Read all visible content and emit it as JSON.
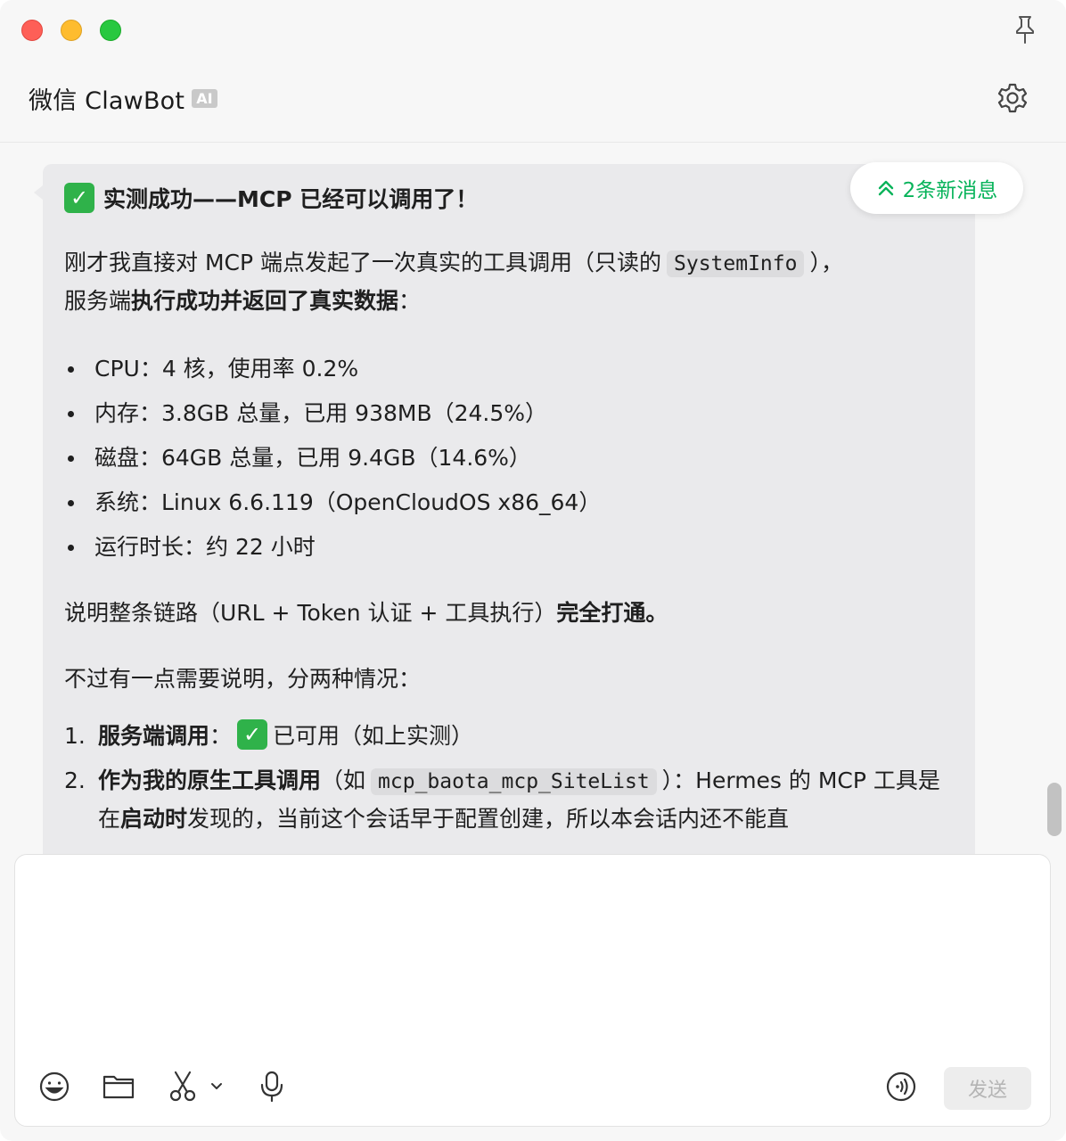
{
  "window": {
    "title": "微信 ClawBot",
    "ai_badge": "AI"
  },
  "chat": {
    "new_messages_label": "2条新消息",
    "message": {
      "heading": "实测成功——MCP 已经可以调用了！",
      "intro_1": "刚才我直接对 MCP 端点发起了一次真实的工具调用（只读的",
      "intro_code": "SystemInfo",
      "intro_2": "），",
      "intro_3": "服务端",
      "intro_bold": "执行成功并返回了真实数据",
      "intro_4": "：",
      "bullets": [
        "CPU：4 核，使用率 0.2%",
        "内存：3.8GB 总量，已用 938MB（24.5%）",
        "磁盘：64GB 总量，已用 9.4GB（14.6%）",
        "系统：Linux 6.6.119（OpenCloudOS x86_64）",
        "运行时长：约 22 小时"
      ],
      "summary_1": "说明整条链路（URL + Token 认证 + 工具执行）",
      "summary_bold": "完全打通。",
      "note": "不过有一点需要说明，分两种情况：",
      "item1_num": "1.",
      "item1_bold": "服务端调用",
      "item1_colon": "：",
      "item1_text": "已可用（如上实测）",
      "item2_num": "2.",
      "item2_bold": "作为我的原生工具调用",
      "item2_text_1": "（如",
      "item2_code": "mcp_baota_mcp_SiteList",
      "item2_text_2": "）：Hermes 的 MCP 工具是在",
      "item2_bold2": "启动时",
      "item2_text_3": "发现的，当前这个会话早于配置创建，所以本会话内还不能直"
    }
  },
  "composer": {
    "input_value": "",
    "send_label": "发送",
    "icons": [
      "emoji-icon",
      "folder-icon",
      "scissors-icon",
      "chevron-down-icon",
      "microphone-icon",
      "voice-input-icon"
    ]
  },
  "colors": {
    "accent_green": "#07b35a",
    "check_green": "#2fb24a",
    "bubble_bg": "#eaeaec"
  }
}
